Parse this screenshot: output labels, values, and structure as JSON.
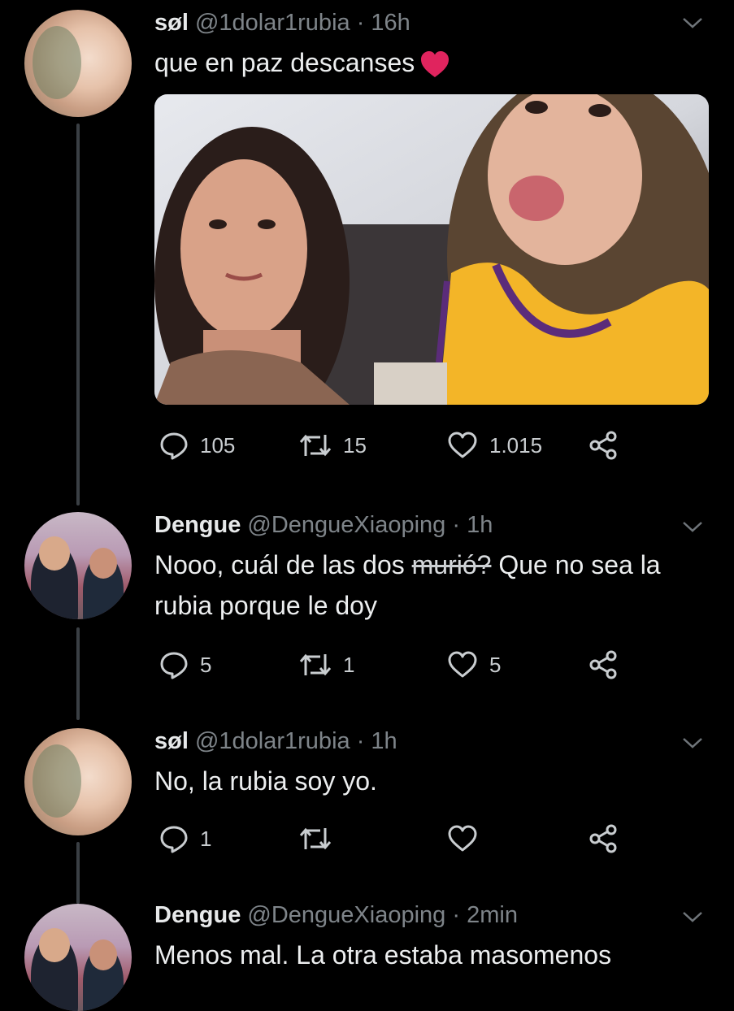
{
  "tweets": [
    {
      "name": "søl",
      "handle": "@1dolar1rubia",
      "time": "· 16h",
      "text": "que en paz descanses",
      "emoji": "heart",
      "replies": "105",
      "retweets": "15",
      "likes": "1.015"
    },
    {
      "name": "Dengue",
      "handle": "@DengueXiaoping",
      "time": "· 1h",
      "text_before": "Nooo, cuál de las dos ",
      "text_struck": "murió?",
      "text_after": " Que no sea la rubia porque le doy",
      "replies": "5",
      "retweets": "1",
      "likes": "5"
    },
    {
      "name": "søl",
      "handle": "@1dolar1rubia",
      "time": "· 1h",
      "text": "No, la rubia soy yo.",
      "replies": "1",
      "retweets": "",
      "likes": ""
    },
    {
      "name": "Dengue",
      "handle": "@DengueXiaoping",
      "time": "· 2min",
      "text": "Menos mal. La otra estaba masomenos"
    }
  ],
  "colors": {
    "background": "#000000",
    "text": "#e7e9ea",
    "muted": "#7e8489",
    "icon": "#c9cdd0",
    "heart": "#e0245e"
  },
  "icons": [
    "reply-icon",
    "retweet-icon",
    "like-icon",
    "share-icon",
    "chevron-down-icon",
    "heart-emoji"
  ]
}
